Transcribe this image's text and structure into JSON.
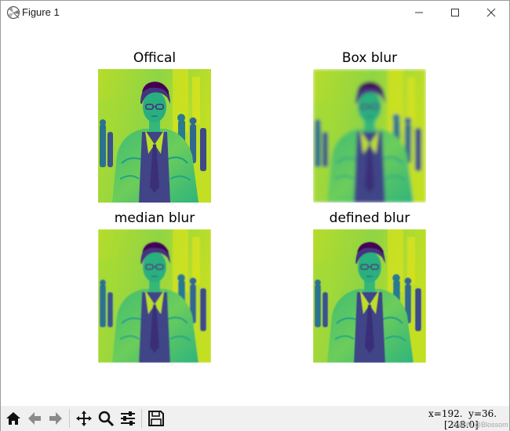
{
  "window": {
    "title": "Figure 1"
  },
  "figure": {
    "subplots": [
      {
        "title": "Offical",
        "image": "portrait-viridis-sharp"
      },
      {
        "title": "Box blur",
        "image": "portrait-viridis-box-blur"
      },
      {
        "title": "median blur",
        "image": "portrait-viridis-median-blur"
      },
      {
        "title": "defined blur",
        "image": "portrait-viridis-defined-blur"
      }
    ],
    "colormap": [
      "#440154",
      "#3b528b",
      "#21918c",
      "#5ec962",
      "#c8e020",
      "#fde725"
    ]
  },
  "toolbar": {
    "icons": [
      "home-icon",
      "back-arrow-icon",
      "forward-arrow-icon",
      "pan-move-icon",
      "zoom-magnifier-icon",
      "configure-subplots-icon",
      "save-floppy-icon"
    ],
    "coords_line1": "x=192.  y=36.",
    "coords_line2": "[248.0]",
    "watermark": "CSDN @Blossom"
  }
}
